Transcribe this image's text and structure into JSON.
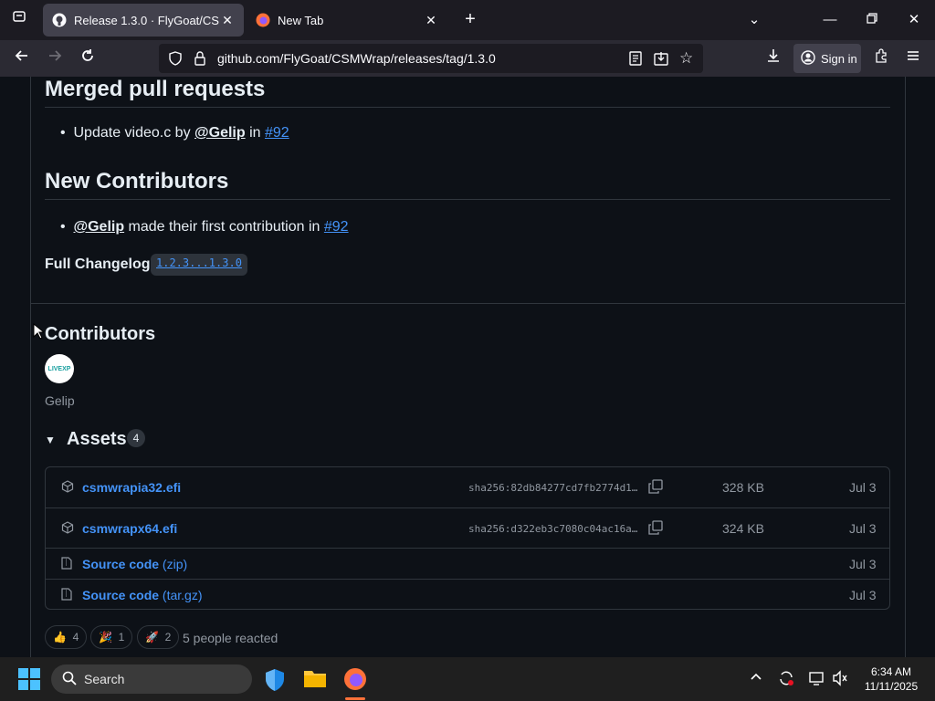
{
  "browser": {
    "tabs": [
      {
        "title": "Release 1.3.0 · FlyGoat/CSMWrap",
        "close": "✕"
      },
      {
        "title": "New Tab",
        "close": "✕"
      }
    ],
    "url": "github.com/FlyGoat/CSMWrap/releases/tag/1.3.0",
    "sign_in": "Sign in"
  },
  "release": {
    "merged_heading": "Merged pull requests",
    "merged_items": [
      {
        "text": "Update video.c by ",
        "user": "@Gelip",
        "mid": " in ",
        "link": "#92"
      }
    ],
    "new_contrib_heading": "New Contributors",
    "new_contrib_items": [
      {
        "user": "@Gelip",
        "text": " made their first contribution in ",
        "link": "#92"
      }
    ],
    "changelog_label": "Full Changelog:",
    "changelog_link": "1.2.3...1.3.0"
  },
  "contributors": {
    "heading": "Contributors",
    "avatar_text": "LIVEXP",
    "name": "Gelip"
  },
  "assets": {
    "heading": "Assets",
    "count": "4",
    "items": [
      {
        "name": "csmwrapia32.efi",
        "sub": "",
        "sha": "sha256:82db84277cd7fb2774d1…",
        "size": "328 KB",
        "date": "Jul 3"
      },
      {
        "name": "csmwrapx64.efi",
        "sub": "",
        "sha": "sha256:d322eb3c7080c04ac16a…",
        "size": "324 KB",
        "date": "Jul 3"
      },
      {
        "name": "Source code",
        "sub": " (zip)",
        "sha": "",
        "size": "",
        "date": "Jul 3"
      },
      {
        "name": "Source code",
        "sub": " (tar.gz)",
        "sha": "",
        "size": "",
        "date": "Jul 3"
      }
    ]
  },
  "reactions": {
    "items": [
      {
        "emoji": "👍",
        "count": "4"
      },
      {
        "emoji": "🎉",
        "count": "1"
      },
      {
        "emoji": "🚀",
        "count": "2"
      }
    ],
    "summary": "5 people reacted"
  },
  "taskbar": {
    "search": "Search",
    "time": "6:34 AM",
    "date": "11/11/2025"
  }
}
